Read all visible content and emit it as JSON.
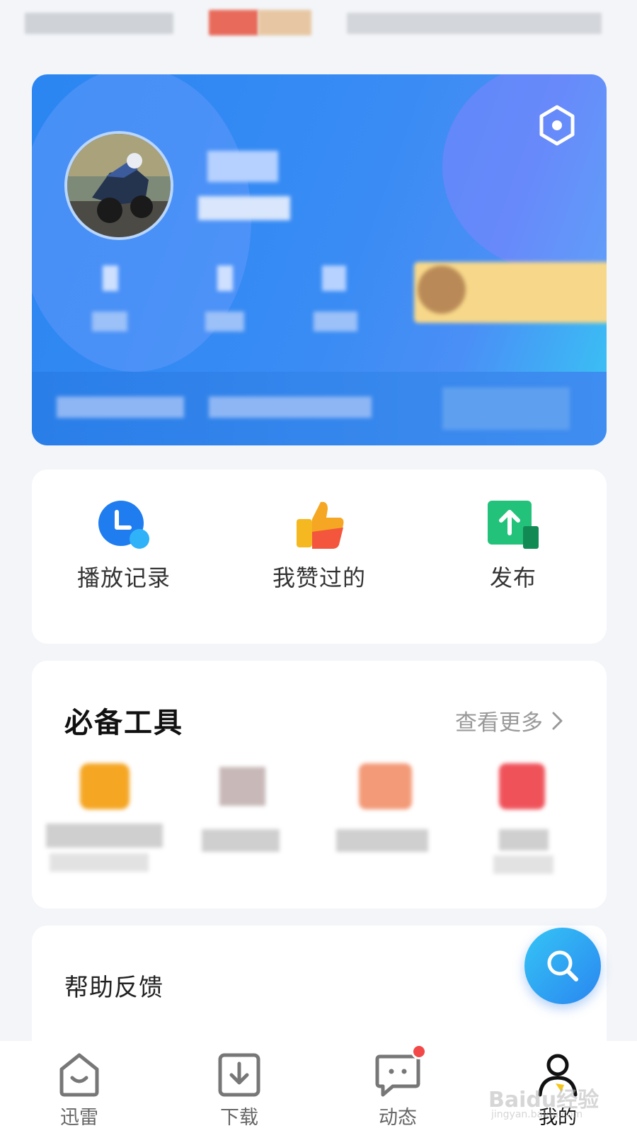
{
  "quick_actions": [
    {
      "label": "播放记录",
      "icon": "clock-icon",
      "color": "#1f7df0"
    },
    {
      "label": "我赞过的",
      "icon": "thumbs-up-icon",
      "color": "#f5a623"
    },
    {
      "label": "发布",
      "icon": "upload-icon",
      "color": "#23c27a"
    }
  ],
  "tools": {
    "title": "必备工具",
    "more_label": "查看更多"
  },
  "help": {
    "label": "帮助反馈"
  },
  "fab": {
    "icon": "search-icon"
  },
  "tab_bar": {
    "tabs": [
      {
        "label": "迅雷",
        "icon": "home-icon",
        "active": false
      },
      {
        "label": "下载",
        "icon": "download-icon",
        "active": false
      },
      {
        "label": "动态",
        "icon": "message-icon",
        "active": false,
        "badge": true
      },
      {
        "label": "我的",
        "icon": "profile-icon",
        "active": true
      }
    ]
  },
  "watermark": {
    "text": "Baidu经验",
    "sub": "jingyan.baidu.com"
  },
  "colors": {
    "accent": "#2b86f2",
    "background": "#f3f5f8",
    "badge": "#f24848"
  }
}
